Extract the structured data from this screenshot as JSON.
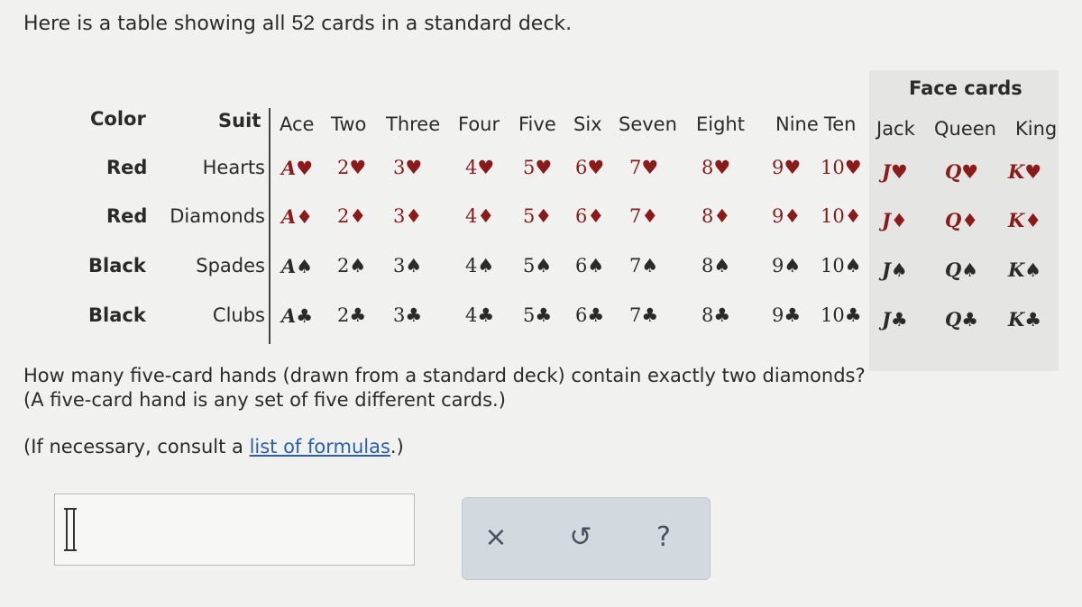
{
  "intro": {
    "before": "Here is a table showing all ",
    "number": "52",
    "after": " cards in a standard deck."
  },
  "table": {
    "face_cards_label": "Face cards",
    "color_header": "Color",
    "suit_header": "Suit",
    "rank_headers": [
      "Ace",
      "Two",
      "Three",
      "Four",
      "Five",
      "Six",
      "Seven",
      "Eight",
      "Nine",
      "Ten",
      "Jack",
      "Queen",
      "King"
    ],
    "rows": [
      {
        "color": "Red",
        "suit": "Hearts",
        "tone": "red",
        "cards": [
          "A♥",
          "2♥",
          "3♥",
          "4♥",
          "5♥",
          "6♥",
          "7♥",
          "8♥",
          "9♥",
          "10♥",
          "J♥",
          "Q♥",
          "K♥"
        ]
      },
      {
        "color": "Red",
        "suit": "Diamonds",
        "tone": "red",
        "cards": [
          "A♦",
          "2♦",
          "3♦",
          "4♦",
          "5♦",
          "6♦",
          "7♦",
          "8♦",
          "9♦",
          "10♦",
          "J♦",
          "Q♦",
          "K♦"
        ]
      },
      {
        "color": "Black",
        "suit": "Spades",
        "tone": "black",
        "cards": [
          "A♠",
          "2♠",
          "3♠",
          "4♠",
          "5♠",
          "6♠",
          "7♠",
          "8♠",
          "9♠",
          "10♠",
          "J♠",
          "Q♠",
          "K♠"
        ]
      },
      {
        "color": "Black",
        "suit": "Clubs",
        "tone": "black",
        "cards": [
          "A♣",
          "2♣",
          "3♣",
          "4♣",
          "5♣",
          "6♣",
          "7♣",
          "8♣",
          "9♣",
          "10♣",
          "J♣",
          "Q♣",
          "K♣"
        ]
      }
    ]
  },
  "question": {
    "line1": "How many five-card hands (drawn from a standard deck) contain exactly two diamonds?",
    "line2": "(A five-card hand is any set of five different cards.)"
  },
  "hint": {
    "before": "(If necessary, consult a ",
    "link": "list of formulas",
    "after": ".)"
  },
  "answer": {
    "value": ""
  },
  "buttons": {
    "clear": "×",
    "undo": "↺",
    "help": "?"
  }
}
